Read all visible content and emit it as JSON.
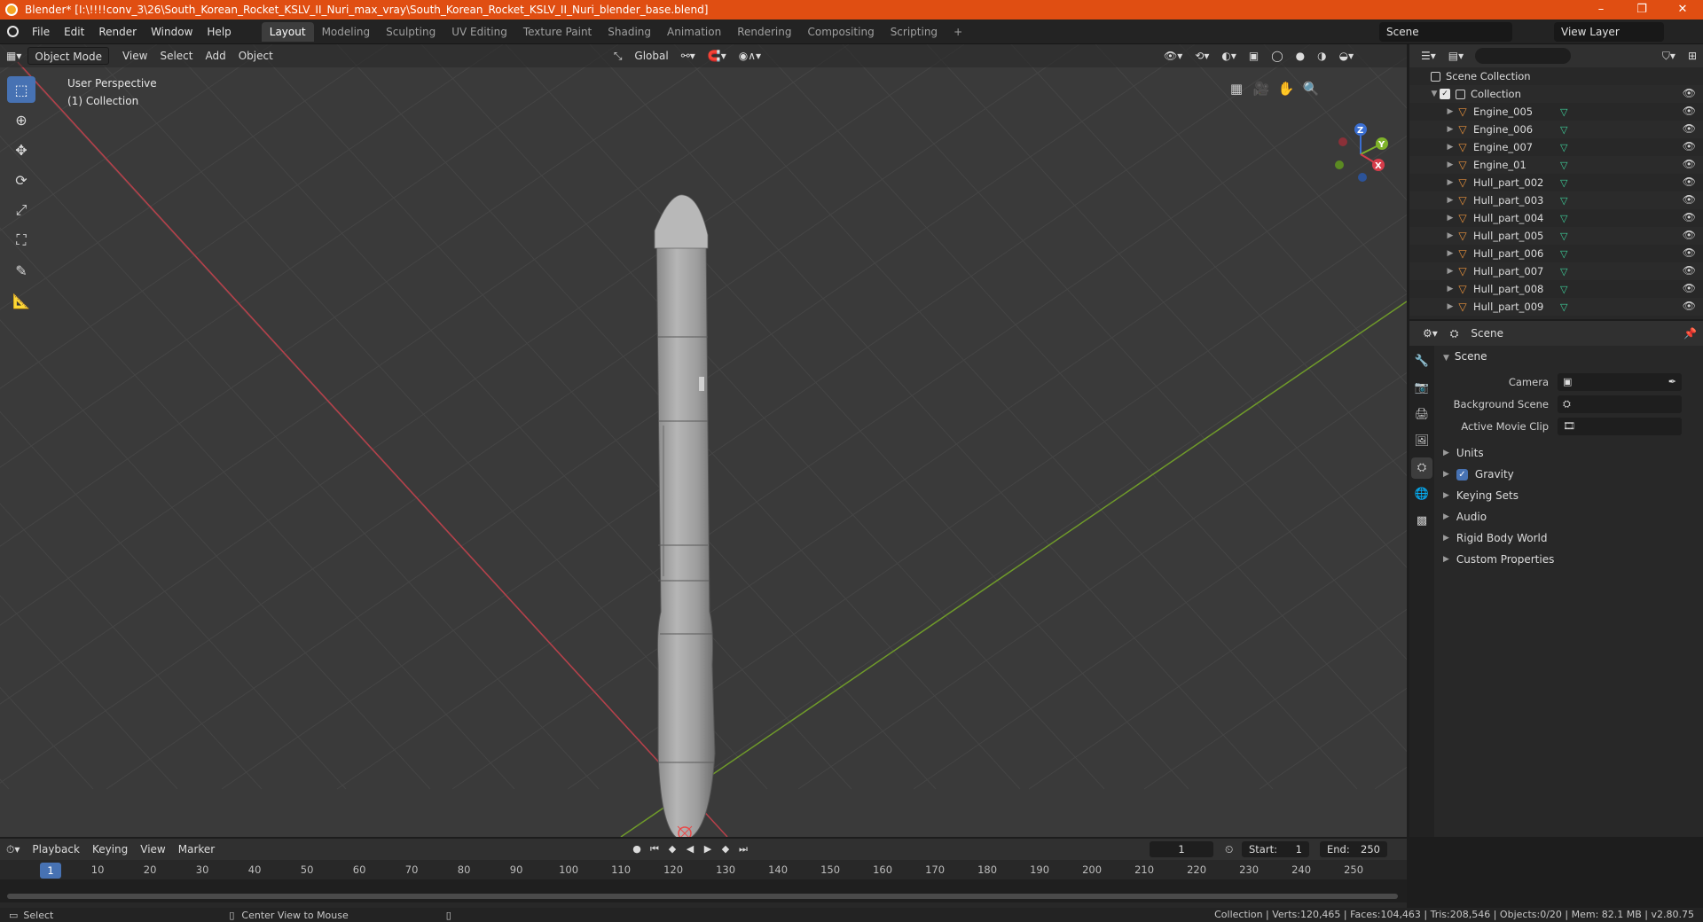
{
  "window": {
    "title": "Blender* [I:\\!!!!conv_3\\26\\South_Korean_Rocket_KSLV_II_Nuri_max_vray\\South_Korean_Rocket_KSLV_II_Nuri_blender_base.blend]",
    "minimize": "–",
    "restore": "❐",
    "close": "✕"
  },
  "menu": [
    "File",
    "Edit",
    "Render",
    "Window",
    "Help"
  ],
  "workspaces": [
    "Layout",
    "Modeling",
    "Sculpting",
    "UV Editing",
    "Texture Paint",
    "Shading",
    "Animation",
    "Rendering",
    "Compositing",
    "Scripting"
  ],
  "workspace_add": "+",
  "scene_field": "Scene",
  "view_layer_field": "View Layer",
  "viewport": {
    "mode": "Object Mode",
    "menus": [
      "View",
      "Select",
      "Add",
      "Object"
    ],
    "transform": "Global",
    "perspective": "User Perspective",
    "collection": "(1) Collection",
    "gizmo": {
      "z": "Z",
      "y": "Y",
      "x": "X"
    }
  },
  "outliner": {
    "search_placeholder": "",
    "scene_collection": "Scene Collection",
    "collection": "Collection",
    "objects": [
      "Engine_005",
      "Engine_006",
      "Engine_007",
      "Engine_01",
      "Hull_part_002",
      "Hull_part_003",
      "Hull_part_004",
      "Hull_part_005",
      "Hull_part_006",
      "Hull_part_007",
      "Hull_part_008",
      "Hull_part_009"
    ]
  },
  "properties": {
    "context": "Scene",
    "panel": "Scene",
    "camera_label": "Camera",
    "background_label": "Background Scene",
    "movie_clip_label": "Active Movie Clip",
    "subpanels": [
      "Units",
      "Gravity",
      "Keying Sets",
      "Audio",
      "Rigid Body World",
      "Custom Properties"
    ]
  },
  "timeline": {
    "menus": [
      "Playback",
      "Keying",
      "View",
      "Marker"
    ],
    "current_frame": "1",
    "start_label": "Start:",
    "start": "1",
    "end_label": "End:",
    "end": "250",
    "ticks": [
      "10",
      "20",
      "30",
      "40",
      "50",
      "60",
      "70",
      "80",
      "90",
      "100",
      "110",
      "120",
      "130",
      "140",
      "150",
      "160",
      "170",
      "180",
      "190",
      "200",
      "210",
      "220",
      "230",
      "240",
      "250"
    ]
  },
  "statusbar": {
    "select": "Select",
    "center_view": "Center View to Mouse",
    "stats": "Collection | Verts:120,465 | Faces:104,463 | Tris:208,546 | Objects:0/20 | Mem: 82.1 MB | v2.80.75"
  }
}
